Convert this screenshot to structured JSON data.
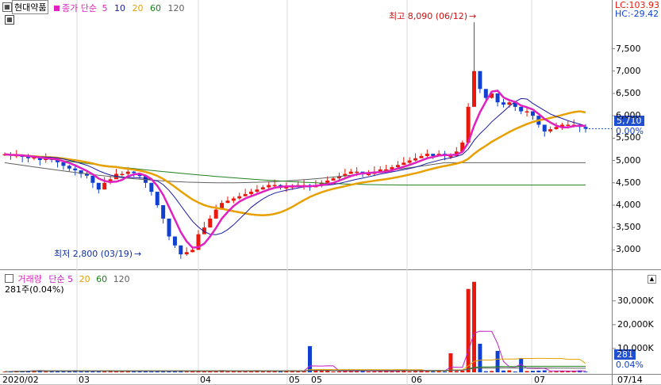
{
  "header": {
    "stock_name": "현대약품",
    "ma_label": "종가 단순",
    "ma_periods": [
      {
        "label": "5",
        "color": "#e020c0"
      },
      {
        "label": "10",
        "color": "#1a1aa0"
      },
      {
        "label": "20",
        "color": "#e8a000"
      },
      {
        "label": "60",
        "color": "#208020"
      },
      {
        "label": "120",
        "color": "#606060"
      }
    ],
    "lc": "LC:103.93",
    "hc": "HC:-29.42"
  },
  "price_panel": {
    "high_annotation": "최고 8,090 (06/12)",
    "low_annotation": "최저 2,800 (03/19)",
    "current_price": "5,710",
    "current_pct": "0.00%",
    "y_ticks": [
      "7,500",
      "7,000",
      "6,500",
      "6,000",
      "5,500",
      "5,000",
      "4,500",
      "4,000",
      "3,500",
      "3,000"
    ]
  },
  "volume_panel": {
    "title": "거래량",
    "ma_label": "단순",
    "ma_periods": [
      {
        "label": "5",
        "color": "#c020c0"
      },
      {
        "label": "20",
        "color": "#e8a000"
      },
      {
        "label": "60",
        "color": "#208020"
      },
      {
        "label": "120",
        "color": "#606060"
      }
    ],
    "info": "281주(0.04%)",
    "current_volume": "281",
    "current_pct": "0.04%",
    "y_ticks": [
      "30,000K",
      "20,000K",
      "10,000K"
    ]
  },
  "x_axis": {
    "labels": [
      "2020/02",
      "03",
      "04",
      "05",
      "05",
      "06",
      "07",
      "07/14"
    ]
  },
  "colors": {
    "up": "#e8180c",
    "down": "#1040d0",
    "ma5": "#e020c0",
    "ma10": "#1a1aa0",
    "ma20": "#e8a000",
    "ma60": "#208020",
    "ma120": "#606060",
    "price_label_bg": "#2050d0"
  },
  "chart_data": {
    "type": "candlestick",
    "y_unit": "KRW",
    "x_range": [
      "2020/02",
      "07/14"
    ],
    "price_range": [
      2800,
      8090
    ],
    "high": {
      "value": 8090,
      "date": "06/12"
    },
    "low": {
      "value": 2800,
      "date": "03/19"
    },
    "last_close": 5710,
    "closes": [
      5140,
      5110,
      5120,
      5080,
      5050,
      5070,
      5010,
      5040,
      5020,
      4960,
      4880,
      4820,
      4780,
      4700,
      4660,
      4500,
      4350,
      4500,
      4580,
      4700,
      4700,
      4750,
      4720,
      4650,
      4500,
      4300,
      4000,
      3700,
      3300,
      3100,
      2900,
      2950,
      3000,
      3350,
      3500,
      3700,
      3900,
      4050,
      4100,
      4150,
      4200,
      4250,
      4300,
      4350,
      4400,
      4450,
      4450,
      4400,
      4400,
      4420,
      4450,
      4450,
      4400,
      4450,
      4500,
      4550,
      4600,
      4650,
      4700,
      4750,
      4750,
      4700,
      4700,
      4750,
      4800,
      4800,
      4850,
      4900,
      4950,
      5000,
      5050,
      5100,
      5150,
      5100,
      5150,
      5100,
      5100,
      5200,
      5400,
      6200,
      7000,
      6600,
      6400,
      6500,
      6300,
      6250,
      6300,
      6200,
      6100,
      6100,
      6000,
      5800,
      5650,
      5700,
      5750,
      5800,
      5800,
      5800,
      5750,
      5710
    ],
    "volume_max_k": 38000,
    "volume_ticks_k": [
      10000,
      20000,
      30000
    ],
    "volume_current": 281
  }
}
